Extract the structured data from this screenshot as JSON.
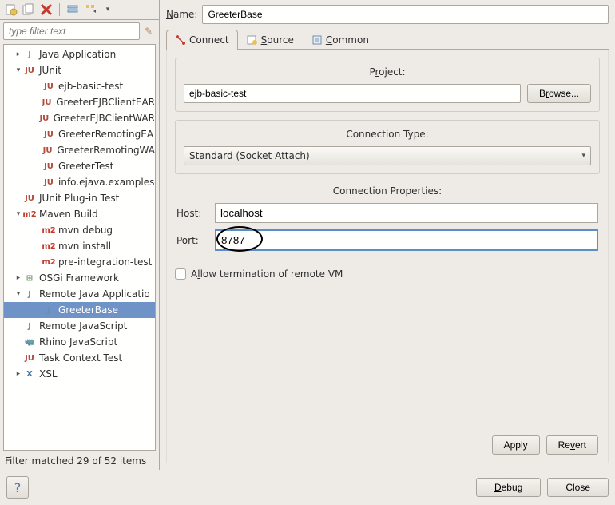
{
  "filter": {
    "placeholder": "type filter text"
  },
  "status": "Filter matched 29 of 52 items",
  "tree": [
    {
      "indent": 12,
      "exp": "▸",
      "icon": "J",
      "iconColor": "#859ca8",
      "label": "Java Application"
    },
    {
      "indent": 12,
      "exp": "▾",
      "icon": "JU",
      "iconColor": "#b04a3a",
      "label": "JUnit"
    },
    {
      "indent": 36,
      "exp": "",
      "icon": "JU",
      "iconColor": "#b04a3a",
      "label": "ejb-basic-test"
    },
    {
      "indent": 36,
      "exp": "",
      "icon": "JU",
      "iconColor": "#b04a3a",
      "label": "GreeterEJBClientEAR"
    },
    {
      "indent": 36,
      "exp": "",
      "icon": "JU",
      "iconColor": "#b04a3a",
      "label": "GreeterEJBClientWAR"
    },
    {
      "indent": 36,
      "exp": "",
      "icon": "JU",
      "iconColor": "#b04a3a",
      "label": "GreeterRemotingEA"
    },
    {
      "indent": 36,
      "exp": "",
      "icon": "JU",
      "iconColor": "#b04a3a",
      "label": "GreeterRemotingWA"
    },
    {
      "indent": 36,
      "exp": "",
      "icon": "JU",
      "iconColor": "#b04a3a",
      "label": "GreeterTest"
    },
    {
      "indent": 36,
      "exp": "",
      "icon": "JU",
      "iconColor": "#b04a3a",
      "label": "info.ejava.examples"
    },
    {
      "indent": 12,
      "exp": "",
      "icon": "JU",
      "iconColor": "#b04a3a",
      "label": "JUnit Plug-in Test",
      "plug": true
    },
    {
      "indent": 12,
      "exp": "▾",
      "icon": "m2",
      "iconColor": "#c43a2e",
      "label": "Maven Build"
    },
    {
      "indent": 36,
      "exp": "",
      "icon": "m2",
      "iconColor": "#c43a2e",
      "label": "mvn debug"
    },
    {
      "indent": 36,
      "exp": "",
      "icon": "m2",
      "iconColor": "#c43a2e",
      "label": "mvn install"
    },
    {
      "indent": 36,
      "exp": "",
      "icon": "m2",
      "iconColor": "#c43a2e",
      "label": "pre-integration-test"
    },
    {
      "indent": 12,
      "exp": "▸",
      "icon": "⊞",
      "iconColor": "#5a8f5a",
      "label": "OSGi Framework"
    },
    {
      "indent": 12,
      "exp": "▾",
      "icon": "J",
      "iconColor": "#6a8fb5",
      "label": "Remote Java Applicatio",
      "remote": true
    },
    {
      "indent": 36,
      "exp": "",
      "icon": "J",
      "iconColor": "#6a8fb5",
      "label": "GreeterBase",
      "remote": true,
      "selected": true
    },
    {
      "indent": 12,
      "exp": "",
      "icon": "J",
      "iconColor": "#6a8fb5",
      "label": "Remote JavaScript",
      "remote": true
    },
    {
      "indent": 12,
      "exp": "",
      "icon": "🦏",
      "iconColor": "#5b73a3",
      "label": "Rhino JavaScript"
    },
    {
      "indent": 12,
      "exp": "",
      "icon": "JU",
      "iconColor": "#b04a3a",
      "label": "Task Context Test"
    },
    {
      "indent": 12,
      "exp": "▸",
      "icon": "X",
      "iconColor": "#4a7aa3",
      "label": "XSL"
    }
  ],
  "name": {
    "label": "Name:",
    "value": "GreeterBase"
  },
  "tabs": {
    "connect": "Connect",
    "source": "Source",
    "common": "Common"
  },
  "project": {
    "title_pre": "P",
    "title_ul": "r",
    "title_post": "oject:",
    "value": "ejb-basic-test",
    "browse_pre": "B",
    "browse_ul": "r",
    "browse_post": "owse..."
  },
  "conn_type": {
    "title": "Connection Type:",
    "value": "Standard (Socket Attach)"
  },
  "conn_props": {
    "title": "Connection Properties:",
    "host_label": "Host:",
    "host_value": "localhost",
    "port_label": "Port:",
    "port_value": "8787"
  },
  "allow_term": {
    "pre": "A",
    "ul": "l",
    "post": "low termination of remote VM"
  },
  "buttons": {
    "apply": "Apply",
    "revert_pre": "Re",
    "revert_ul": "v",
    "revert_post": "ert",
    "debug_pre": "",
    "debug_ul": "D",
    "debug_post": "ebug",
    "close": "Close"
  }
}
